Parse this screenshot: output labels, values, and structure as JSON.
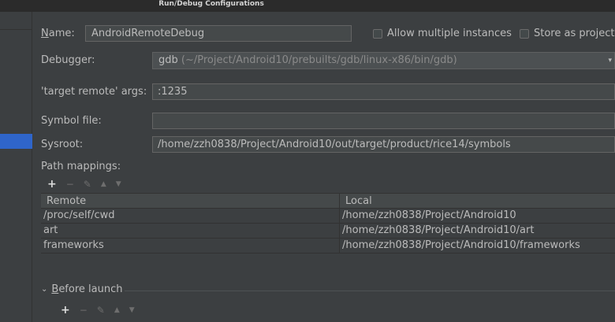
{
  "window": {
    "title": "Run/Debug Configurations"
  },
  "form": {
    "name_label": "Name:",
    "name_value": "AndroidRemoteDebug",
    "allow_multiple_label": "Allow multiple instances",
    "store_as_project_label": "Store as project",
    "debugger_label": "Debugger:",
    "debugger_value": "gdb",
    "debugger_path": "(~/Project/Android10/prebuilts/gdb/linux-x86/bin/gdb)",
    "target_remote_label": "'target remote' args:",
    "target_remote_value": ":1235",
    "symbol_file_label": "Symbol file:",
    "symbol_file_value": "",
    "sysroot_label": "Sysroot:",
    "sysroot_value": "/home/zzh0838/Project/Android10/out/target/product/rice14/symbols",
    "path_mappings_label": "Path mappings:"
  },
  "toolbar": {
    "add": "+",
    "remove": "−",
    "edit": "✎",
    "up": "▲",
    "down": "▼"
  },
  "table": {
    "headers": {
      "remote": "Remote",
      "local": "Local"
    },
    "rows": [
      {
        "remote": "/proc/self/cwd",
        "local": "/home/zzh0838/Project/Android10"
      },
      {
        "remote": "art",
        "local": "/home/zzh0838/Project/Android10/art"
      },
      {
        "remote": "frameworks",
        "local": "/home/zzh0838/Project/Android10/frameworks"
      }
    ]
  },
  "before_launch": {
    "label": "Before launch",
    "chevron": "chevron-down-icon"
  },
  "icons": {
    "dropdown": "▾",
    "chevron": "⌄"
  }
}
